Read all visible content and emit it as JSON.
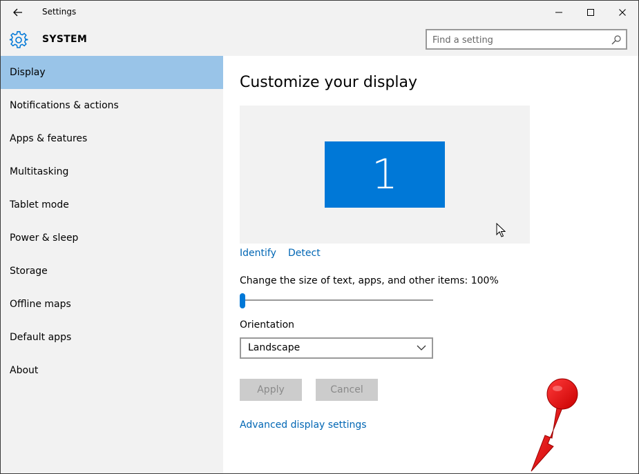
{
  "window": {
    "title": "Settings",
    "back_icon": "back-arrow-icon",
    "controls": [
      "minimize-icon",
      "maximize-icon",
      "close-icon"
    ]
  },
  "header": {
    "section_icon": "gear-icon",
    "section_title": "SYSTEM",
    "search_placeholder": "Find a setting",
    "search_icon": "search-icon"
  },
  "sidebar": {
    "items": [
      {
        "label": "Display",
        "active": true
      },
      {
        "label": "Notifications & actions",
        "active": false
      },
      {
        "label": "Apps & features",
        "active": false
      },
      {
        "label": "Multitasking",
        "active": false
      },
      {
        "label": "Tablet mode",
        "active": false
      },
      {
        "label": "Power & sleep",
        "active": false
      },
      {
        "label": "Storage",
        "active": false
      },
      {
        "label": "Offline maps",
        "active": false
      },
      {
        "label": "Default apps",
        "active": false
      },
      {
        "label": "About",
        "active": false
      }
    ]
  },
  "main": {
    "title": "Customize your display",
    "monitor_number": "1",
    "identify_link": "Identify",
    "detect_link": "Detect",
    "scale_label": "Change the size of text, apps, and other items: 100%",
    "scale_slider_fraction": 0.0,
    "orientation_label": "Orientation",
    "orientation_value": "Landscape",
    "apply_label": "Apply",
    "cancel_label": "Cancel",
    "advanced_link": "Advanced display settings"
  },
  "colors": {
    "accent": "#0078d7",
    "link": "#0066b4",
    "active_nav": "#99c4e8",
    "annotation_arrow": "#e8141b"
  }
}
